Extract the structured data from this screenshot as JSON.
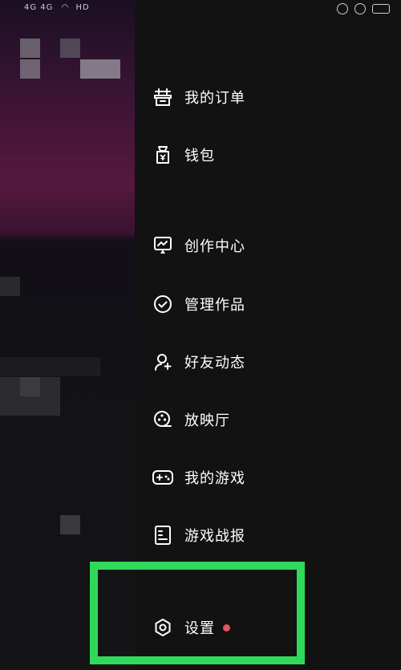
{
  "status_bar": {
    "left_text": "4G 4G",
    "hd_label": "HD"
  },
  "menu": {
    "items": [
      {
        "label": "我的订单",
        "icon": "order-icon"
      },
      {
        "label": "钱包",
        "icon": "wallet-icon"
      },
      {
        "label": "创作中心",
        "icon": "creator-center-icon"
      },
      {
        "label": "管理作品",
        "icon": "manage-works-icon"
      },
      {
        "label": "好友动态",
        "icon": "friend-activity-icon"
      },
      {
        "label": "放映厅",
        "icon": "cinema-icon"
      },
      {
        "label": "我的游戏",
        "icon": "gamepad-icon"
      },
      {
        "label": "游戏战报",
        "icon": "game-report-icon"
      },
      {
        "label": "设置",
        "icon": "settings-icon",
        "has_badge": true
      }
    ]
  },
  "colors": {
    "highlight": "#31d95b",
    "badge": "#e8545b"
  }
}
